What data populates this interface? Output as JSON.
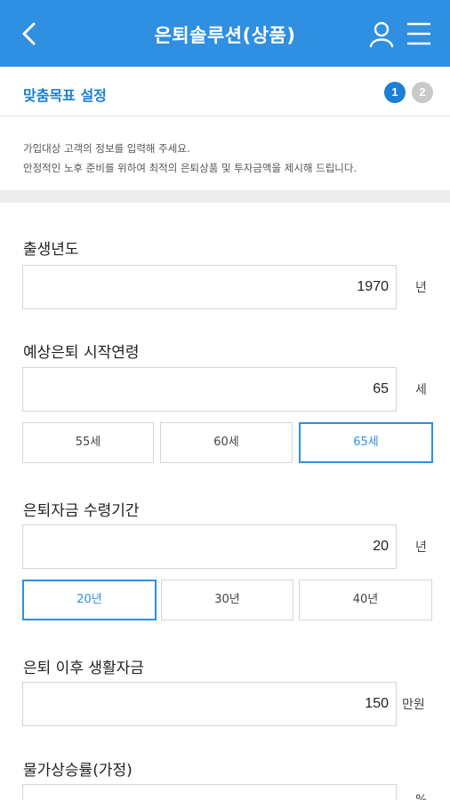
{
  "header": {
    "title": "은퇴솔루션(상품)",
    "back_icon": "chevron-left-icon",
    "user_icon": "user-icon",
    "menu_icon": "hamburger-menu-icon",
    "bg_color": "#2f8fe0"
  },
  "steps": {
    "title": "맞춤목표 설정",
    "items": [
      "1",
      "2"
    ],
    "current": 1
  },
  "description": {
    "line1": "가입대상 고객의 정보를 입력해 주세요.",
    "line2": "안정적인 노후 준비를 위하여 최적의 은퇴상품 및 투자금액을 제시해 드립니다."
  },
  "form": {
    "birth_year": {
      "label": "출생년도",
      "value": "1970",
      "unit": "년"
    },
    "retire_age": {
      "label": "예상은퇴 시작연령",
      "value": "65",
      "unit": "세",
      "options": [
        "55세",
        "60세",
        "65세"
      ],
      "selected": "65세"
    },
    "receive_period": {
      "label": "은퇴자금 수령기간",
      "value": "20",
      "unit": "년",
      "options": [
        "20년",
        "30년",
        "40년"
      ],
      "selected": "20년"
    },
    "living_fund": {
      "label": "은퇴 이후 생활자금",
      "value": "150",
      "unit": "만원"
    },
    "inflation": {
      "label": "물가상승률(가정)",
      "value": "",
      "unit": "%"
    }
  },
  "colors": {
    "accent": "#2f8fe0",
    "step_active": "#1b7fd4",
    "step_inactive": "#c9c9c9"
  }
}
